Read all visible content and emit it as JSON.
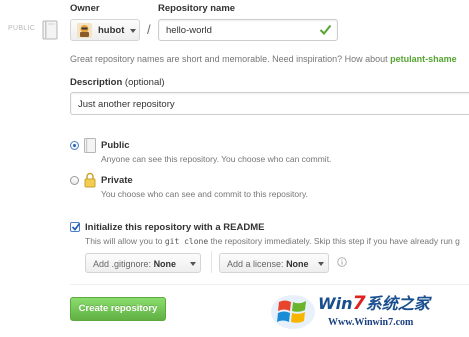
{
  "header": {
    "owner_label": "Owner",
    "repo_name_label": "Repository name"
  },
  "public_badge": "PUBLIC",
  "owner": {
    "name": "hubot"
  },
  "separator": "/",
  "repo_name": {
    "value": "hello-world"
  },
  "hint": {
    "text": "Great repository names are short and memorable. Need inspiration? How about ",
    "suggestion": "petulant-shame"
  },
  "description": {
    "label": "Description",
    "optional": "(optional)",
    "value": "Just another repository"
  },
  "visibility": {
    "public": {
      "title": "Public",
      "desc": "Anyone can see this repository. You choose who can commit.",
      "selected": true
    },
    "private": {
      "title": "Private",
      "desc": "You choose who can see and commit to this repository.",
      "selected": false
    }
  },
  "readme": {
    "checked": true,
    "title": "Initialize this repository with a README",
    "desc_pre": "This will allow you to ",
    "desc_code": "git clone",
    "desc_post": " the repository immediately. Skip this step if you have already run g"
  },
  "gitignore": {
    "prefix": "Add .gitignore:",
    "value": "None"
  },
  "license": {
    "prefix": "Add a license:",
    "value": "None"
  },
  "create_button": "Create repository",
  "watermark": {
    "brand_pre": "Win",
    "brand_seven": "7",
    "brand_post": "系统之家",
    "url": "Www.Winwin7.com"
  },
  "colors": {
    "accent_green": "#55a532",
    "button_green": "#60b044",
    "radio_blue": "#2a62b8"
  },
  "icons": [
    "book-icon",
    "avatar-icon",
    "check-icon",
    "lock-icon",
    "info-icon",
    "caret-down-icon"
  ]
}
